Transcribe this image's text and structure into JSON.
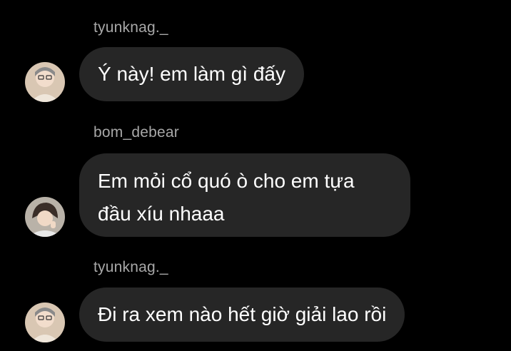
{
  "messages": [
    {
      "sender": "tyunknag._",
      "text": "Ý này! em làm gì đấy",
      "avatar_icon": "user-avatar-icon"
    },
    {
      "sender": "bom_debear",
      "text_lines": [
        "Em mỏi cổ quó ò cho em tựa",
        "đầu xíu nhaaa"
      ],
      "avatar_icon": "user-avatar-icon"
    },
    {
      "sender": "tyunknag._",
      "text": "Đi ra xem nào hết giờ giải lao rồi",
      "avatar_icon": "user-avatar-icon"
    }
  ],
  "colors": {
    "background": "#000000",
    "bubble": "#262626",
    "sender_name": "#a8a8a8",
    "message_text": "#ffffff"
  }
}
